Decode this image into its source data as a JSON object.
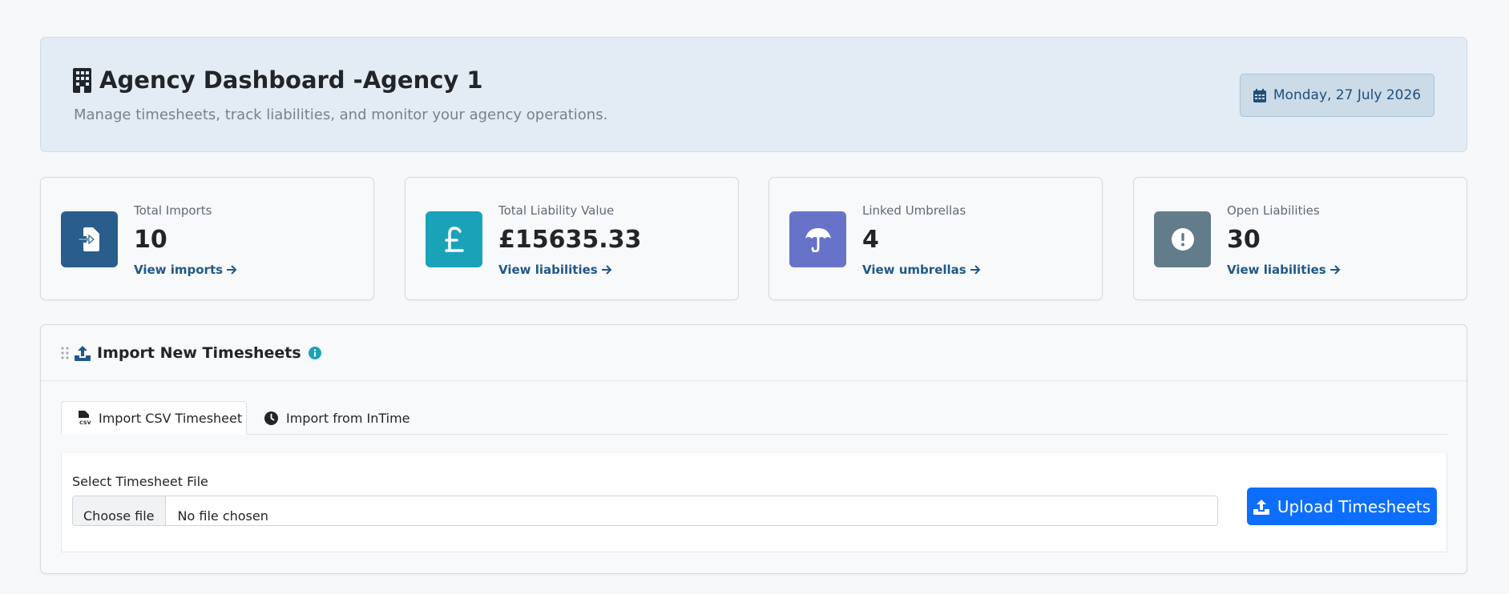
{
  "header": {
    "title": "Agency Dashboard -Agency 1",
    "subtitle": "Manage timesheets, track liabilities, and monitor your agency operations.",
    "date": "Monday, 27 July 2026"
  },
  "cards": [
    {
      "label": "Total Imports",
      "value": "10",
      "link": "View imports",
      "color": "#285d8c",
      "icon": "file-import-icon"
    },
    {
      "label": "Total Liability Value",
      "value": "£15635.33",
      "link": "View liabilities",
      "color": "#1aa2b8",
      "icon": "pound-icon"
    },
    {
      "label": "Linked Umbrellas",
      "value": "4",
      "link": "View umbrellas",
      "color": "#6773c9",
      "icon": "umbrella-icon"
    },
    {
      "label": "Open Liabilities",
      "value": "30",
      "link": "View liabilities",
      "color": "#627d89",
      "icon": "exclamation-circle-icon"
    }
  ],
  "import_panel": {
    "title": "Import New Timesheets",
    "tabs": [
      {
        "label": "Import CSV Timesheet",
        "active": true
      },
      {
        "label": "Import from InTime",
        "active": false
      }
    ],
    "field_label": "Select Timesheet File",
    "choose_file": "Choose file",
    "file_status": "No file chosen",
    "upload_label": "Upload Timesheets"
  },
  "colors": {
    "primary": "#0d6efd",
    "info": "#1aa2b8",
    "link": "#1f5889"
  }
}
